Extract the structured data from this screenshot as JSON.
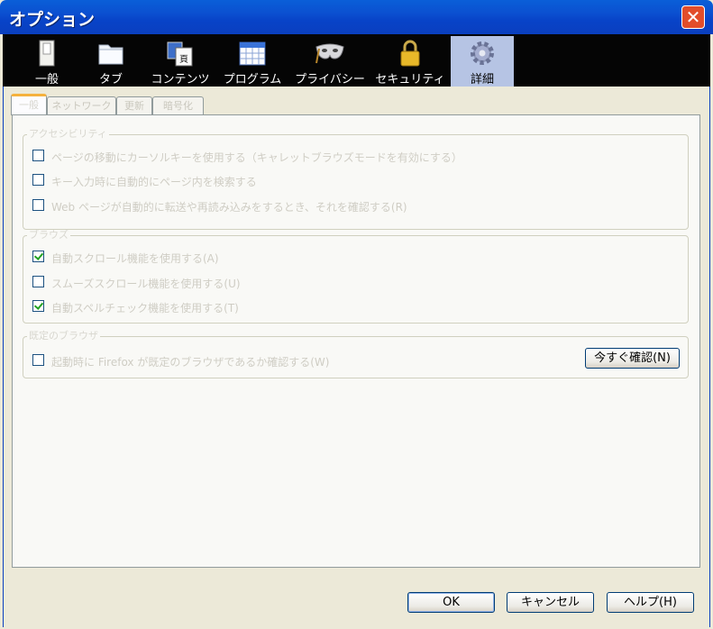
{
  "window": {
    "title": "オプション",
    "close_glyph": "✕"
  },
  "toolbar": {
    "items": [
      {
        "label": "一般",
        "icon": "general-switch-icon"
      },
      {
        "label": "タブ",
        "icon": "tabs-folder-icon"
      },
      {
        "label": "コンテンツ",
        "icon": "content-page-icon"
      },
      {
        "label": "プログラム",
        "icon": "applications-calendar-icon"
      },
      {
        "label": "プライバシー",
        "icon": "privacy-mask-icon"
      },
      {
        "label": "セキュリティ",
        "icon": "security-lock-icon"
      },
      {
        "label": "詳細",
        "icon": "advanced-gear-icon"
      }
    ],
    "selected": "詳細"
  },
  "subtabs": [
    "一般",
    "ネットワーク",
    "更新",
    "暗号化"
  ],
  "groups": {
    "accessibility": {
      "label": "アクセシビリティ",
      "rows": [
        {
          "label": "ページの移動にカーソルキーを使用する（キャレットブラウズモードを有効にする）",
          "checked": false
        },
        {
          "label": "キー入力時に自動的にページ内を検索する",
          "checked": false
        },
        {
          "label": "Web ページが自動的に転送や再読み込みをするとき、それを確認する(R)",
          "checked": false
        }
      ]
    },
    "browsing": {
      "label": "ブラウズ",
      "rows": [
        {
          "label": "自動スクロール機能を使用する(A)",
          "checked": true
        },
        {
          "label": "スムーズスクロール機能を使用する(U)",
          "checked": false
        },
        {
          "label": "自動スペルチェック機能を使用する(T)",
          "checked": true
        }
      ]
    },
    "default_browser": {
      "label": "既定のブラウザ",
      "check_label": "起動時に Firefox が既定のブラウザであるか確認する(W)",
      "checked": false,
      "button": "今すぐ確認(N)"
    }
  },
  "footer": {
    "ok": "OK",
    "cancel": "キャンセル",
    "help": "ヘルプ(H)"
  }
}
